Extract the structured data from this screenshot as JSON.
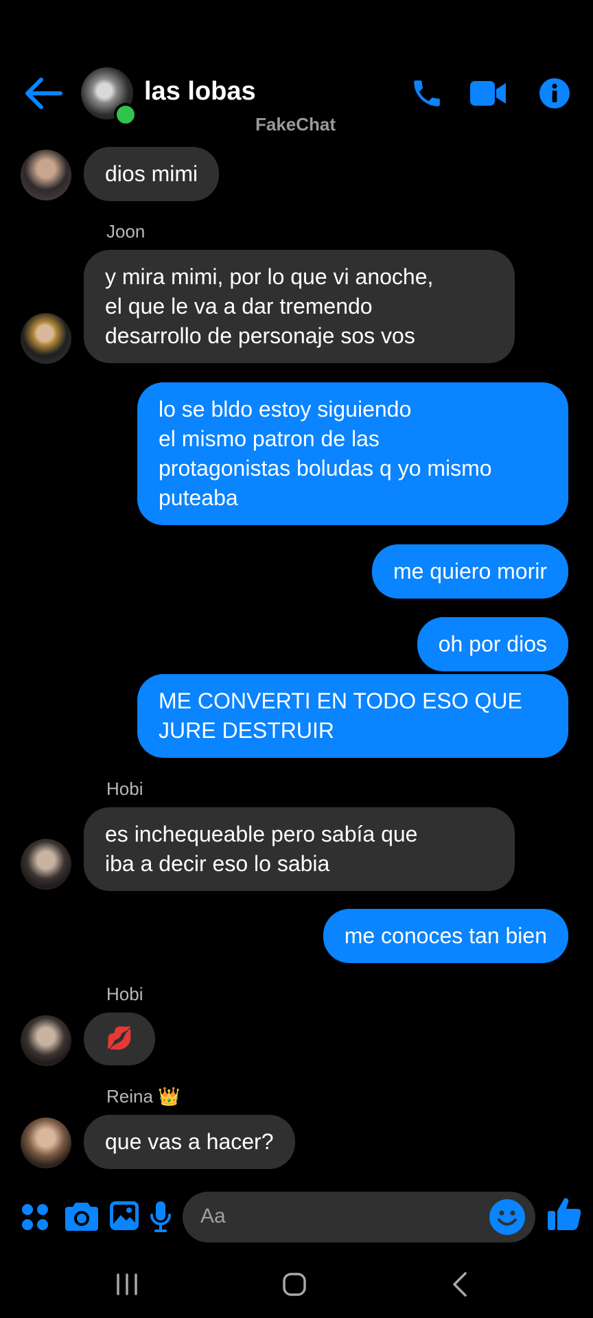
{
  "header": {
    "title": "las lobas",
    "watermark": "FakeChat",
    "icons": [
      "back-arrow-icon",
      "phone-icon",
      "video-camera-icon",
      "info-icon"
    ]
  },
  "colors": {
    "accent": "#0a84ff",
    "incoming_bubble": "#303030",
    "background": "#000000",
    "online": "#31c24d"
  },
  "messages": [
    {
      "direction": "in",
      "text": "dios mimi"
    },
    {
      "direction": "in",
      "sender": "Joon",
      "text": "y mira mimi, por lo que vi anoche,\nel que le va a dar tremendo\ndesarrollo de personaje sos vos"
    },
    {
      "direction": "out",
      "text": "lo se bldo estoy siguiendo\nel mismo patron de las\nprotagonistas boludas q yo mismo\nputeaba"
    },
    {
      "direction": "out",
      "text": "me quiero morir"
    },
    {
      "direction": "out",
      "text": "oh por dios"
    },
    {
      "direction": "out",
      "text": "ME CONVERTI EN TODO ESO QUE\nJURE DESTRUIR"
    },
    {
      "direction": "in",
      "sender": "Hobi",
      "text": "es inchequeable pero sabía que\niba a decir eso lo sabia"
    },
    {
      "direction": "out",
      "text": "me conoces tan bien"
    },
    {
      "direction": "in",
      "sender": "Hobi",
      "text": "💋"
    },
    {
      "direction": "in",
      "sender": "Reina 👑",
      "text": "que vas a hacer?"
    }
  ],
  "composer": {
    "placeholder": "Aa",
    "icons": [
      "apps-icon",
      "camera-icon",
      "gallery-icon",
      "microphone-icon",
      "emoji-icon",
      "thumbs-up-icon"
    ]
  },
  "navbar": {
    "icons": [
      "recent-apps-icon",
      "home-icon",
      "back-icon"
    ]
  }
}
